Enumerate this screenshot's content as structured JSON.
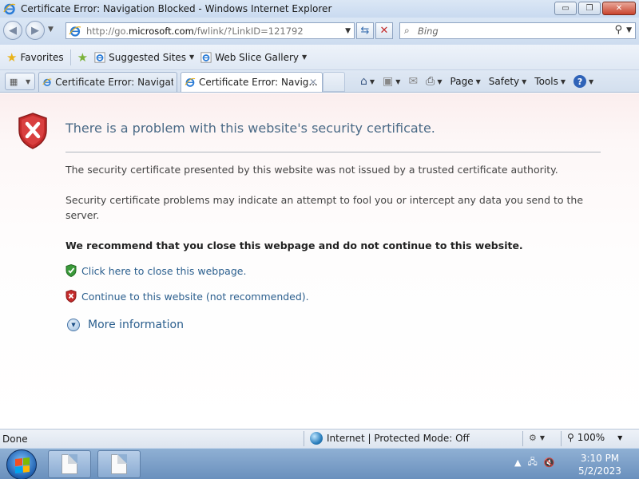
{
  "window": {
    "title": "Certificate Error: Navigation Blocked - Windows Internet Explorer",
    "minimize": "▭",
    "maximize": "❐",
    "close": "✕"
  },
  "address_bar": {
    "url_prefix": "http://go.",
    "url_domain": "microsoft.com",
    "url_suffix": "/fwlink/?LinkID=121792"
  },
  "search": {
    "placeholder": "Bing"
  },
  "favorites_bar": {
    "favorites_label": "Favorites",
    "items": [
      {
        "label": "Suggested Sites"
      },
      {
        "label": "Web Slice Gallery"
      }
    ]
  },
  "tabs": [
    {
      "label": "Certificate Error: Navigatio..."
    },
    {
      "label": "Certificate Error: Navig..."
    }
  ],
  "command_bar": {
    "page": "Page",
    "safety": "Safety",
    "tools": "Tools"
  },
  "content": {
    "title": "There is a problem with this website's security certificate.",
    "para1": "The security certificate presented by this website was not issued by a trusted certificate authority.",
    "para2": "Security certificate problems may indicate an attempt to fool you or intercept any data you send to the server.",
    "recommend": "We recommend that you close this webpage and do not continue to this website.",
    "close_link": "Click here to close this webpage.",
    "continue_link": "Continue to this website (not recommended).",
    "more_info": "More information"
  },
  "status_bar": {
    "status": "Done",
    "zone": "Internet | Protected Mode: Off",
    "zoom": "100%"
  },
  "taskbar": {
    "time": "3:10 PM",
    "date": "5/2/2023"
  },
  "colors": {
    "link": "#2b5f8e",
    "title": "#4a6a86",
    "error_red": "#c42b2b",
    "ok_green": "#3a9a3a"
  }
}
